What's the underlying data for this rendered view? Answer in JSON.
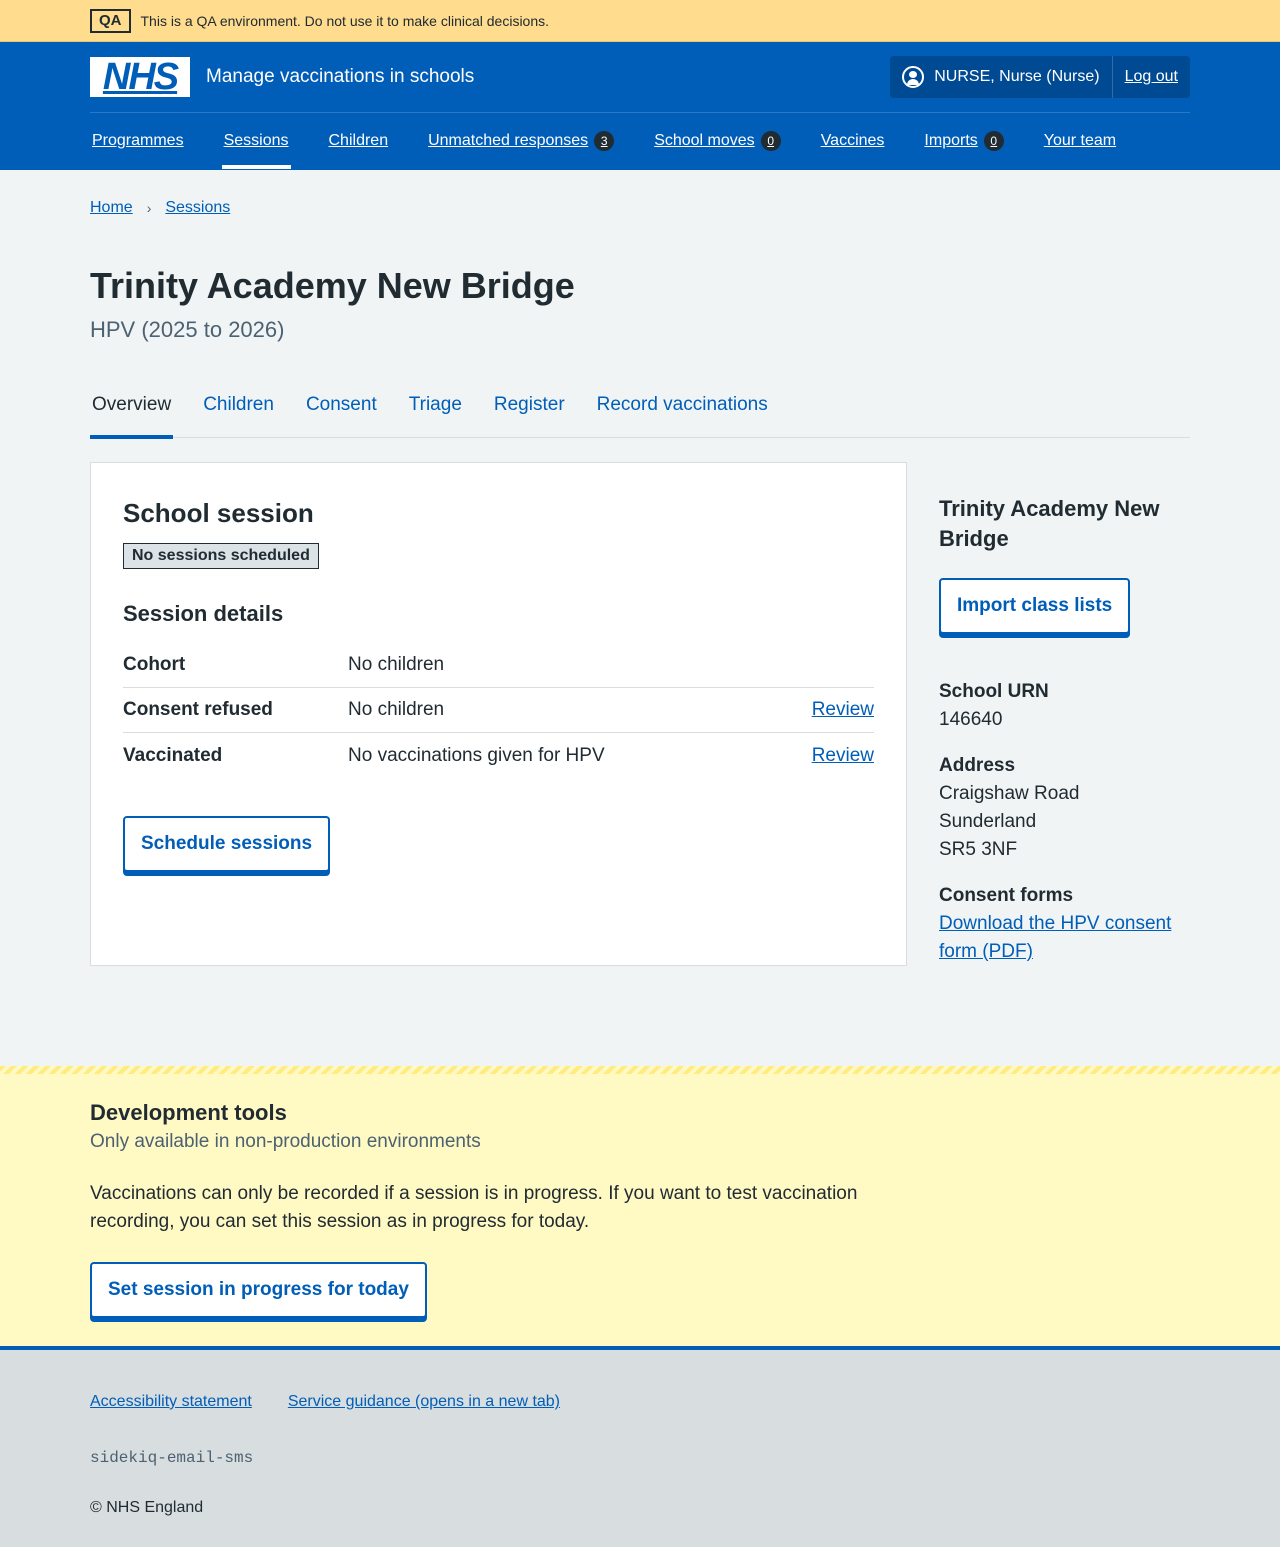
{
  "qa_banner": {
    "tag": "QA",
    "message": "This is a QA environment. Do not use it to make clinical decisions."
  },
  "header": {
    "logo_text": "NHS",
    "service_name": "Manage vaccinations in schools",
    "user": "NURSE, Nurse (Nurse)",
    "logout": "Log out",
    "nav": [
      {
        "label": "Programmes"
      },
      {
        "label": "Sessions",
        "active": true
      },
      {
        "label": "Children"
      },
      {
        "label": "Unmatched responses",
        "count": "3"
      },
      {
        "label": "School moves",
        "count": "0"
      },
      {
        "label": "Vaccines"
      },
      {
        "label": "Imports",
        "count": "0"
      },
      {
        "label": "Your team"
      }
    ]
  },
  "breadcrumb": [
    "Home",
    "Sessions"
  ],
  "page": {
    "title": "Trinity Academy New Bridge",
    "caption": "HPV (2025 to 2026)",
    "tabs": [
      "Overview",
      "Children",
      "Consent",
      "Triage",
      "Register",
      "Record vaccinations"
    ]
  },
  "card": {
    "title": "School session",
    "status_tag": "No sessions scheduled",
    "details_heading": "Session details",
    "rows": [
      {
        "key": "Cohort",
        "value": "No children",
        "action": ""
      },
      {
        "key": "Consent refused",
        "value": "No children",
        "action": "Review"
      },
      {
        "key": "Vaccinated",
        "value": "No vaccinations given for HPV",
        "action": "Review"
      }
    ],
    "button": "Schedule sessions"
  },
  "sidebar": {
    "title": "Trinity Academy New Bridge",
    "button": "Import class lists",
    "urn_label": "School URN",
    "urn": "146640",
    "address_label": "Address",
    "address": [
      "Craigshaw Road",
      "Sunderland",
      "SR5 3NF"
    ],
    "consent_label": "Consent forms",
    "consent_link": "Download the HPV consent form (PDF)"
  },
  "devtools": {
    "title": "Development tools",
    "subtitle": "Only available in non-production environments",
    "description": "Vaccinations can only be recorded if a session is in progress. If you want to test vaccination recording, you can set this session as in progress for today.",
    "button": "Set session in progress for today"
  },
  "footer": {
    "links": [
      "Accessibility statement",
      "Service guidance (opens in a new tab)"
    ],
    "code": "sidekiq-email-sms",
    "copyright": "© NHS England"
  }
}
